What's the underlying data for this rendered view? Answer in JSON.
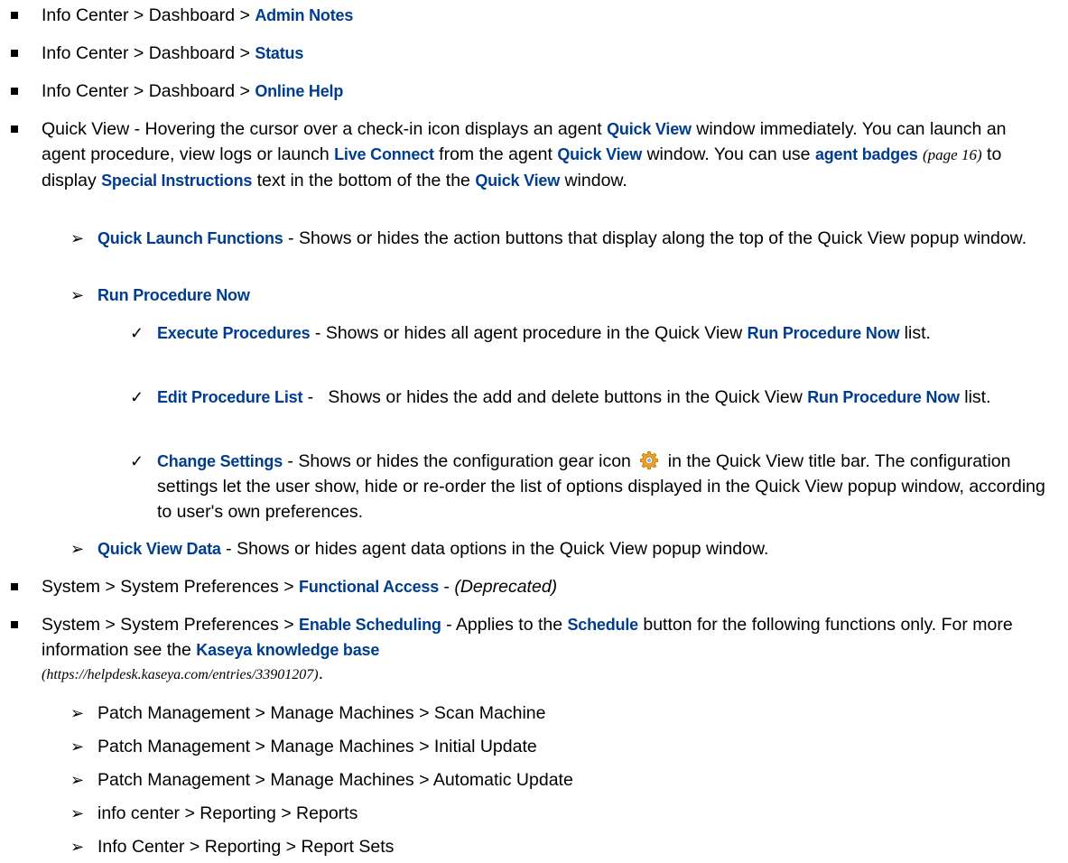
{
  "items": {
    "admin_notes": {
      "prefix": "Info Center > Dashboard > ",
      "link": "Admin Notes"
    },
    "status": {
      "prefix": "Info Center > Dashboard > ",
      "link": "Status"
    },
    "online_help": {
      "prefix": "Info Center > Dashboard > ",
      "link": "Online Help"
    },
    "quick_view": {
      "t1": "Quick View - Hovering the cursor over a check-in icon displays an agent ",
      "l1": "Quick View",
      "t2": " window immediately. You can launch an agent procedure, view logs or launch ",
      "l2": "Live Connect",
      "t3": " from the agent ",
      "l3": "Quick View",
      "t4": " window. You can use ",
      "l4": "agent badges",
      "pageref": "(page 16)",
      "t5": " to display ",
      "l5": "Special Instructions",
      "t6": " text in the bottom of the the ",
      "l6": "Quick View",
      "t7": " window."
    },
    "quick_launch": {
      "link": "Quick Launch Functions",
      "text": " - Shows or hides the action buttons that display along the top of the Quick View popup window."
    },
    "run_procedure": {
      "link": "Run Procedure Now"
    },
    "execute_procedures": {
      "link": "Execute Procedures",
      "text": " - Shows or hides all agent procedure in the Quick View ",
      "link2": "Run Procedure Now",
      "text2": " list."
    },
    "edit_procedure_list": {
      "link": "Edit Procedure List",
      "text": " -   Shows or hides the add and delete buttons in the Quick View ",
      "link2": "Run Procedure Now",
      "text2": " list."
    },
    "change_settings": {
      "link": "Change Settings",
      "text": " - Shows or hides the configuration gear icon ",
      "text2": " in the Quick View title bar. The configuration settings let the user show, hide or re-order the list of options displayed in the Quick View popup window, according to user's own preferences."
    },
    "quick_view_data": {
      "link": "Quick View Data",
      "text": " - Shows or hides agent data options in the Quick View popup window."
    },
    "functional_access": {
      "prefix": "System > System Preferences > ",
      "link": "Functional Access",
      "dash": " - ",
      "italic": "(Deprecated)"
    },
    "enable_scheduling": {
      "prefix": "System > System Preferences > ",
      "link": "Enable Scheduling",
      "t1": " - Applies to the ",
      "link2": "Schedule",
      "t2": " button for the following functions only. For more information see the ",
      "link3": "Kaseya knowledge base",
      "url": "(https://helpdesk.kaseya.com/entries/33901207)",
      "end": "."
    },
    "sched_list": [
      "Patch Management > Manage Machines > Scan Machine",
      "Patch Management > Manage Machines > Initial Update",
      "Patch Management > Manage Machines > Automatic Update",
      "info center > Reporting > Reports",
      "Info Center > Reporting > Report Sets"
    ]
  },
  "glyphs": {
    "arrow": "➢",
    "check": "✓"
  },
  "colors": {
    "link": "#003d8f",
    "gear": "#f0a020"
  },
  "icons": {
    "gear": "gear-icon"
  }
}
